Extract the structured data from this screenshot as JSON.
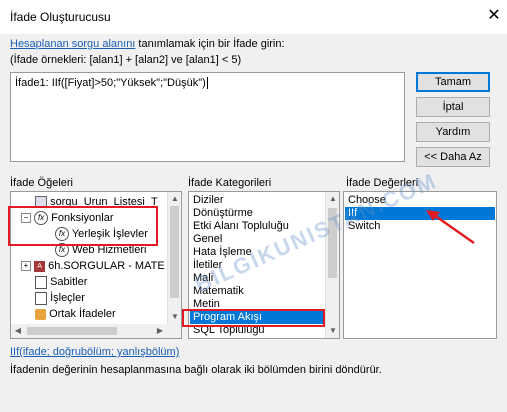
{
  "window": {
    "title": "İfade Oluşturucusu",
    "close_glyph": "✕"
  },
  "instructions": {
    "link_text": "Hesaplanan sorgu alanını",
    "rest_text": " tanımlamak için bir İfade girin:",
    "examples": "(İfade örnekleri: [alan1] + [alan2] ve [alan1] < 5)"
  },
  "expression": {
    "value": "İfade1: IIf([Fiyat]>50;\"Yüksek\";\"Düşük\")"
  },
  "buttons": {
    "ok": "Tamam",
    "cancel": "İptal",
    "help": "Yardım",
    "less": "<< Daha Az"
  },
  "panes": {
    "elements_label": "İfade Öğeleri",
    "categories_label": "İfade Kategorileri",
    "values_label": "İfade Değerleri"
  },
  "elements_tree": [
    {
      "text": "sorgu_Urun_Listesi_T",
      "icon": "query-icon",
      "expander": ""
    },
    {
      "text": "Fonksiyonlar",
      "icon": "function-icon",
      "expander": "−"
    },
    {
      "text": "Yerleşik İşlevler",
      "icon": "function-icon",
      "expander": ""
    },
    {
      "text": "Web Hizmetleri",
      "icon": "function-icon",
      "expander": ""
    },
    {
      "text": "6h.SORGULAR - MATE",
      "icon": "database-icon",
      "expander": "+"
    },
    {
      "text": "Sabitler",
      "icon": "constants-icon",
      "expander": ""
    },
    {
      "text": "İşleçler",
      "icon": "operators-icon",
      "expander": ""
    },
    {
      "text": "Ortak İfadeler",
      "icon": "common-expressions-icon",
      "expander": ""
    }
  ],
  "categories": [
    "Diziler",
    "Dönüştürme",
    "Etki Alanı Topluluğu",
    "Genel",
    "Hata İşleme",
    "İletiler",
    "Mali",
    "Matematik",
    "Metin",
    "Program Akışı",
    "SQL Topluluğu"
  ],
  "categories_selected": "Program Akışı",
  "values": [
    "Choose",
    "IIf",
    "Switch"
  ],
  "values_selected": "IIf",
  "footer": {
    "syntax": "IIf(ifade; doğrubölüm; yanlışbölüm)",
    "description": "İfadenin değerinin hesaplanmasına bağlı olarak iki bölümden birini döndürür."
  },
  "watermark": "BILGIKUNISTAN.COM",
  "colors": {
    "selection": "#0078d7",
    "highlight_box": "#e01b24",
    "link": "#1a5fb4"
  }
}
